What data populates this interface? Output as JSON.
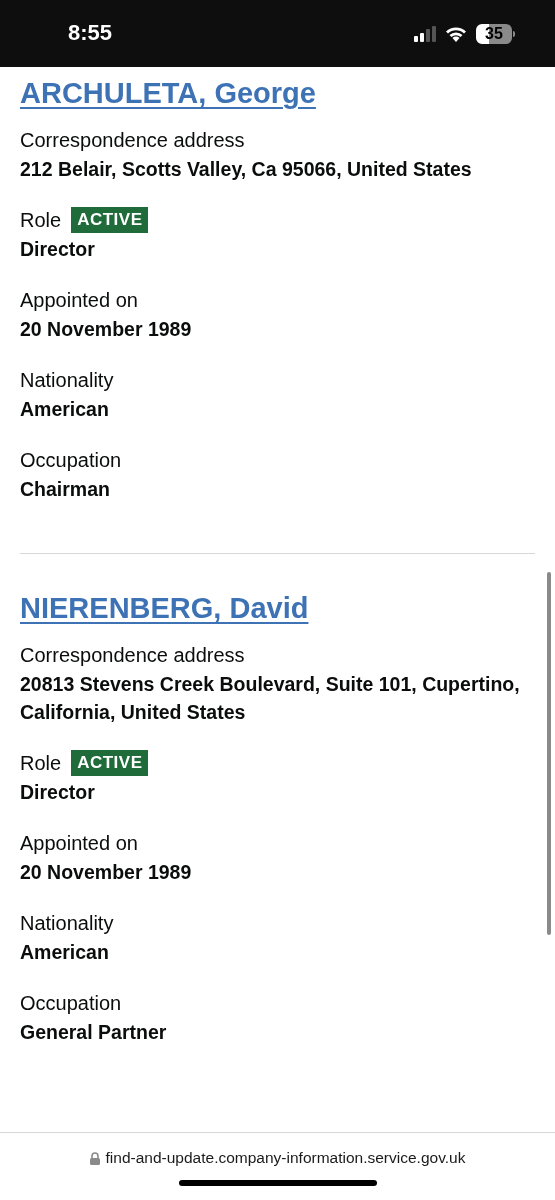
{
  "status_bar": {
    "time": "8:55",
    "battery": "35"
  },
  "officers": [
    {
      "name": "ARCHULETA, George",
      "fields": [
        {
          "label": "Correspondence address",
          "value": "212 Belair, Scotts Valley, Ca 95066, United States"
        },
        {
          "label": "Role",
          "tag": "ACTIVE",
          "value": "Director"
        },
        {
          "label": "Appointed on",
          "value": "20 November 1989"
        },
        {
          "label": "Nationality",
          "value": "American"
        },
        {
          "label": "Occupation",
          "value": "Chairman"
        }
      ]
    },
    {
      "name": "NIERENBERG, David",
      "fields": [
        {
          "label": "Correspondence address",
          "value": "20813 Stevens Creek Boulevard, Suite 101, Cupertino, California, United States"
        },
        {
          "label": "Role",
          "tag": "ACTIVE",
          "value": "Director"
        },
        {
          "label": "Appointed on",
          "value": "20 November 1989"
        },
        {
          "label": "Nationality",
          "value": "American"
        },
        {
          "label": "Occupation",
          "value": "General Partner"
        }
      ]
    }
  ],
  "address_bar": {
    "url": "find-and-update.company-information.service.gov.uk"
  }
}
